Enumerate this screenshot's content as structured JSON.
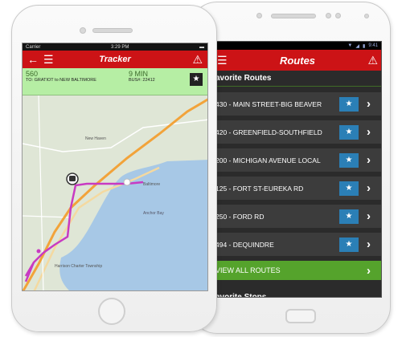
{
  "tracker_screen": {
    "status_bar": {
      "carrier": "Carrier",
      "time": "3:29 PM"
    },
    "header": {
      "title": "Tracker"
    },
    "trip": {
      "route_number": "560",
      "destination": "TO: GRATIOT to NEW BALTIMORE",
      "eta": "9 MIN",
      "bus": "BUS#: 22412"
    },
    "map": {
      "labels": {
        "new_haven": "New Haven",
        "baltimore": "Baltimore",
        "anchor_bay": "Anchor Bay",
        "harrison": "Harrison Charter Township"
      }
    }
  },
  "routes_screen": {
    "status_bar": {
      "time": "9:41"
    },
    "header": {
      "title": "Routes"
    },
    "favorite_routes_heading": "avorite Routes",
    "routes": [
      {
        "name": "430 - MAIN STREET-BIG BEAVER"
      },
      {
        "name": "420 - GREENFIELD-SOUTHFIELD"
      },
      {
        "name": "200 - MICHIGAN AVENUE LOCAL"
      },
      {
        "name": "125 - FORT ST-EUREKA RD"
      },
      {
        "name": "250 - FORD RD"
      },
      {
        "name": "494 - DEQUINDRE"
      }
    ],
    "view_all_label": "VIEW ALL ROUTES",
    "favorite_stops_heading": "avorite Stops"
  },
  "colors": {
    "header_red": "#cc1316",
    "route_green": "#b6eea4",
    "route_pink": "#c83ac2",
    "route_orange": "#f2a33a",
    "star_blue": "#2b7fb6",
    "view_all_green": "#55a32c"
  }
}
